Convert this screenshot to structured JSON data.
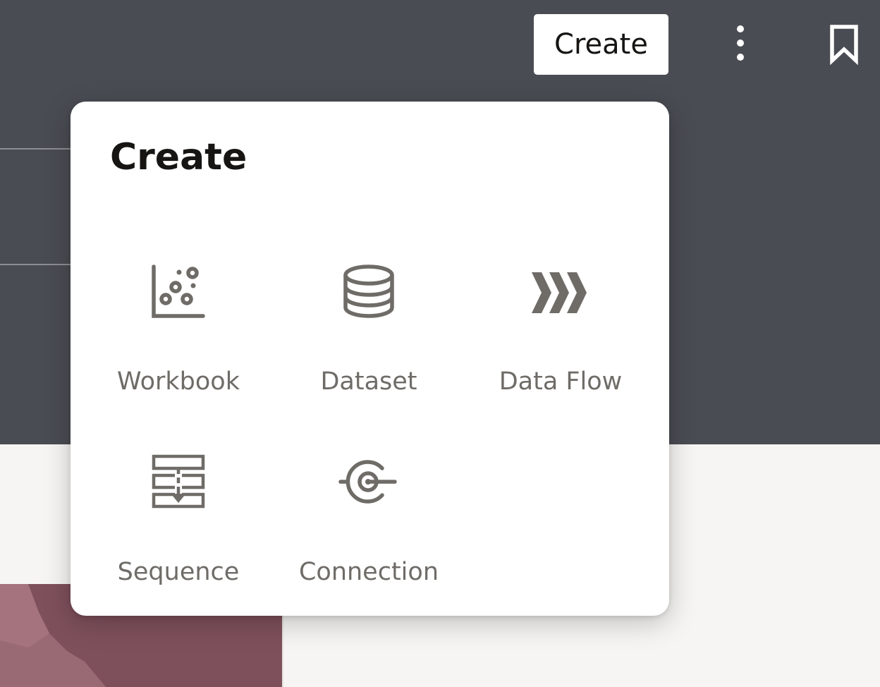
{
  "header": {
    "create_button_label": "Create",
    "more_icon": "vertical-ellipsis-icon",
    "bookmark_icon": "bookmark-icon"
  },
  "create_menu": {
    "title": "Create",
    "items": [
      {
        "label": "Workbook",
        "icon": "scatter-chart-icon"
      },
      {
        "label": "Dataset",
        "icon": "database-icon"
      },
      {
        "label": "Data Flow",
        "icon": "chevrons-right-icon"
      },
      {
        "label": "Sequence",
        "icon": "sequence-icon"
      },
      {
        "label": "Connection",
        "icon": "connection-plug-icon"
      }
    ]
  },
  "colors": {
    "header_background": "#4a4c53",
    "page_background": "#f6f5f3",
    "popup_background": "#ffffff",
    "icon_gray": "#6f6c68",
    "text_dark": "#161513",
    "map_maroon": "#7e505b"
  }
}
